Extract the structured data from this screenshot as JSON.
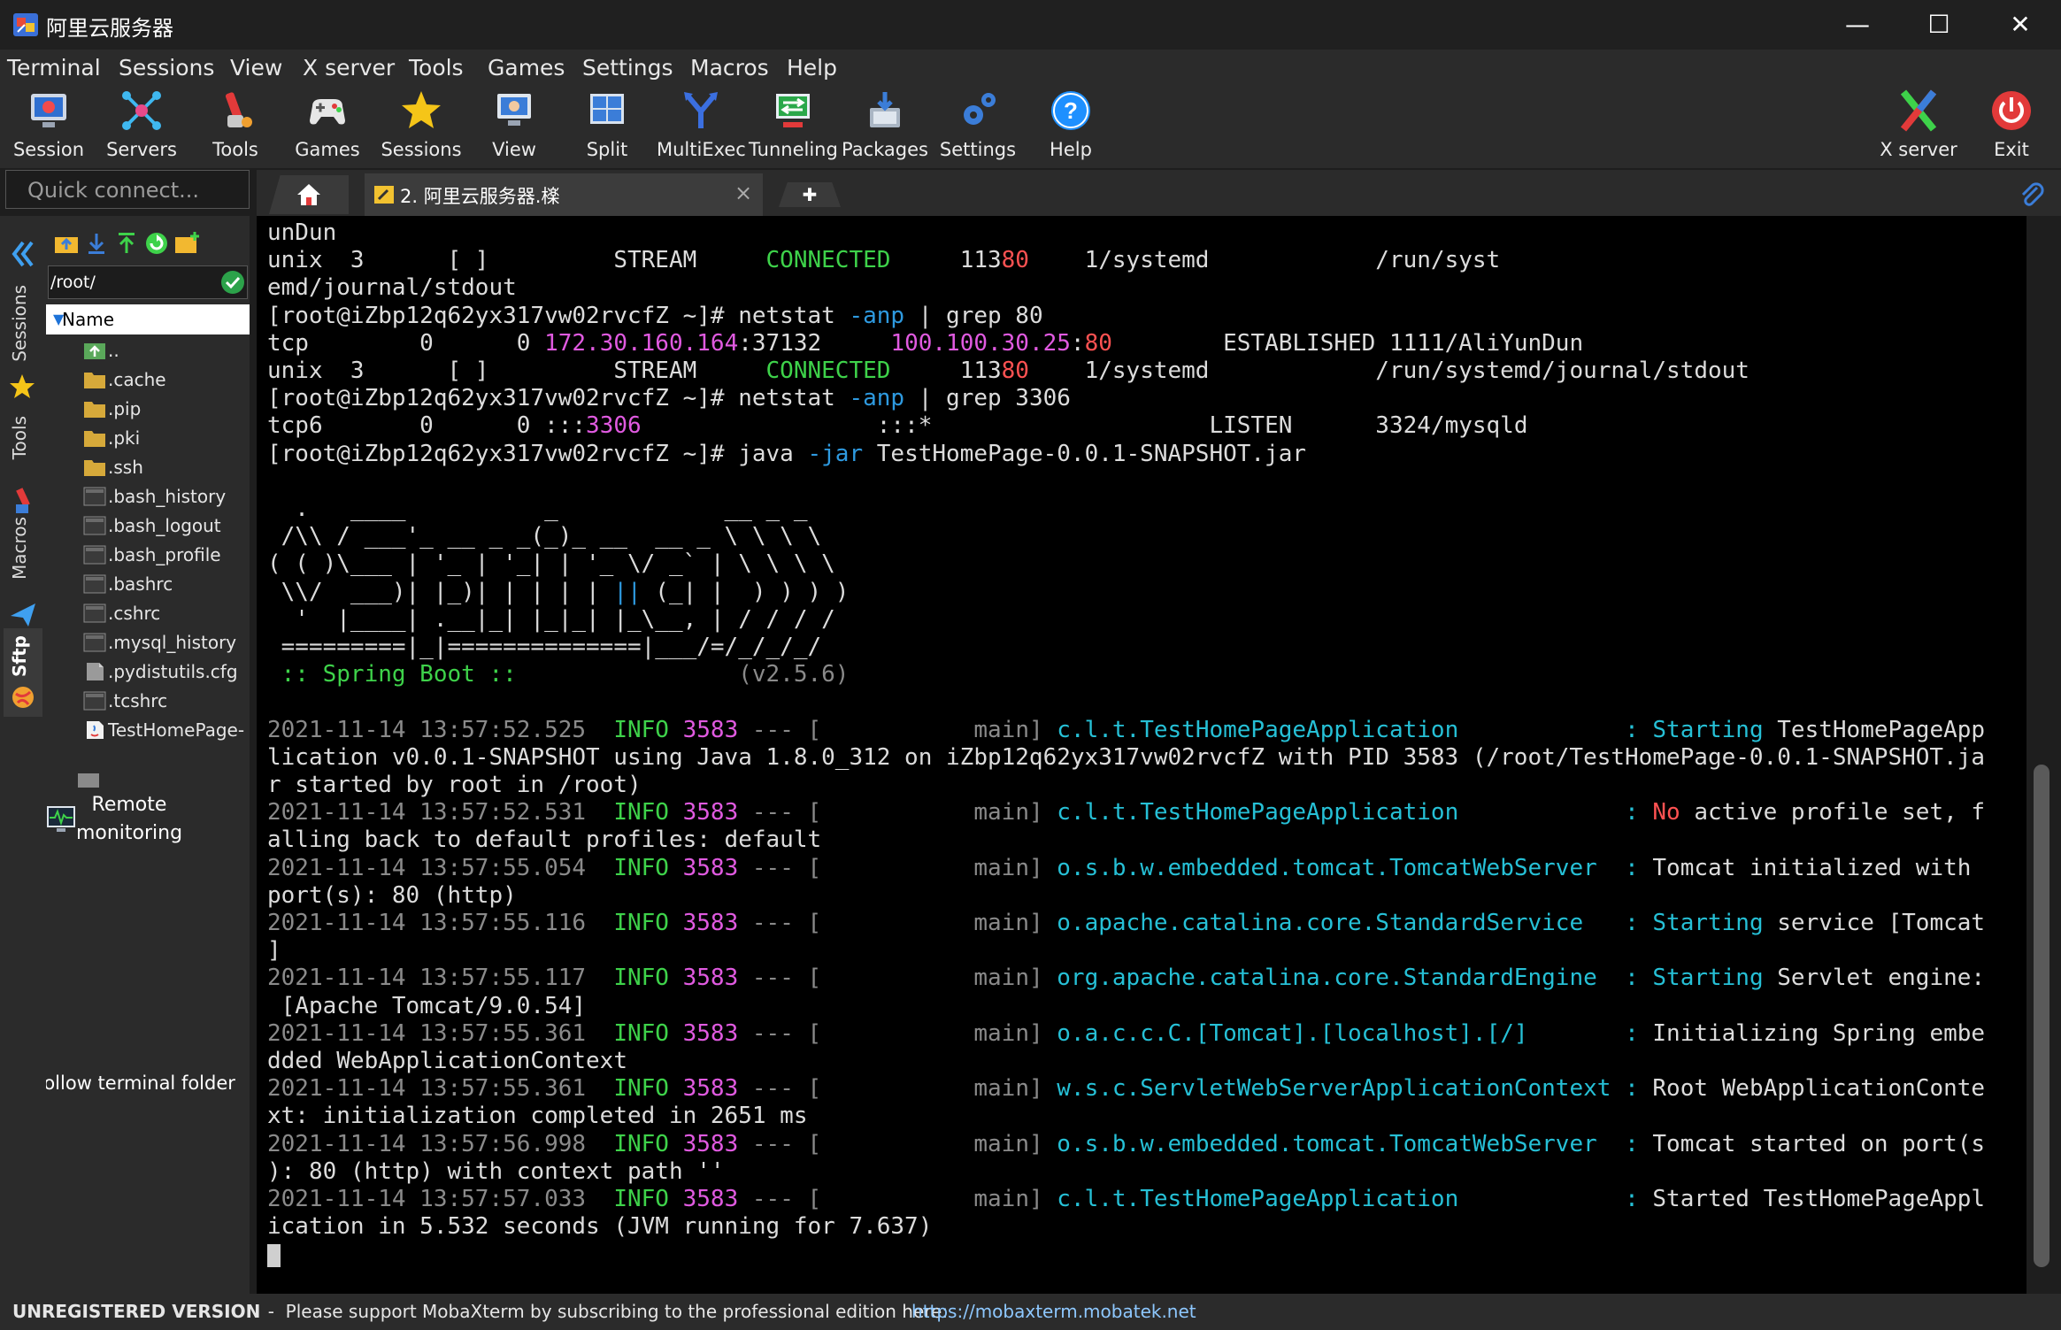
{
  "window": {
    "title": "阿里云服务器",
    "minimize_glyph": "—",
    "maximize_glyph": "☐",
    "close_glyph": "✕"
  },
  "menu": [
    "Terminal",
    "Sessions",
    "View",
    "X server",
    "Tools",
    "Games",
    "Settings",
    "Macros",
    "Help"
  ],
  "toolbar": {
    "items": [
      {
        "label": "Session",
        "icon": "session-icon"
      },
      {
        "label": "Servers",
        "icon": "servers-icon"
      },
      {
        "label": "Tools",
        "icon": "tools-icon"
      },
      {
        "label": "Games",
        "icon": "games-icon"
      },
      {
        "label": "Sessions",
        "icon": "sessions-star-icon"
      },
      {
        "label": "View",
        "icon": "view-icon"
      },
      {
        "label": "Split",
        "icon": "split-icon"
      },
      {
        "label": "MultiExec",
        "icon": "multiexec-icon"
      },
      {
        "label": "Tunneling",
        "icon": "tunneling-icon"
      },
      {
        "label": "Packages",
        "icon": "packages-icon"
      },
      {
        "label": "Settings",
        "icon": "settings-icon"
      },
      {
        "label": "Help",
        "icon": "help-icon"
      }
    ],
    "right": [
      {
        "label": "X server",
        "icon": "xserver-icon"
      },
      {
        "label": "Exit",
        "icon": "exit-icon"
      }
    ]
  },
  "quick_connect": {
    "placeholder": "Quick connect..."
  },
  "tabs": {
    "active_label": "2. 阿里云服务器.檪",
    "close_glyph": "×",
    "new_glyph": "✚"
  },
  "side_tabs": [
    "Sessions",
    "Tools",
    "Macros",
    "Sftp"
  ],
  "sftp": {
    "path": "/root/",
    "column_header": "Name",
    "files": [
      {
        "name": "..",
        "type": "up"
      },
      {
        "name": ".cache",
        "type": "folder"
      },
      {
        "name": ".pip",
        "type": "folder"
      },
      {
        "name": ".pki",
        "type": "folder"
      },
      {
        "name": ".ssh",
        "type": "folder"
      },
      {
        "name": ".bash_history",
        "type": "file"
      },
      {
        "name": ".bash_logout",
        "type": "file"
      },
      {
        "name": ".bash_profile",
        "type": "file"
      },
      {
        "name": ".bashrc",
        "type": "file"
      },
      {
        "name": ".cshrc",
        "type": "file"
      },
      {
        "name": ".mysql_history",
        "type": "file"
      },
      {
        "name": ".pydistutils.cfg",
        "type": "cfg"
      },
      {
        "name": ".tcshrc",
        "type": "file"
      },
      {
        "name": "TestHomePage-",
        "type": "jar"
      }
    ],
    "remote_monitoring": "Remote\nmonitoring",
    "follow_folder": "Follow terminal folder"
  },
  "colors": {
    "green": "#3ed24a",
    "red": "#ff5252",
    "magenta": "#e05ae0",
    "blue": "#2e9ae0",
    "cyan": "#26c0d6",
    "white": "#dcdcdc",
    "gray": "#8a8a8a",
    "bright": "#f2f2f2"
  },
  "terminal": {
    "lines": [
      [
        [
          "unDun",
          "white"
        ]
      ],
      [
        [
          "unix  3      [ ]         STREAM     ",
          "white"
        ],
        [
          "CONNECTED",
          "green"
        ],
        [
          "     113",
          "white"
        ],
        [
          "80",
          "red"
        ],
        [
          "    1/systemd            /run/syst",
          "white"
        ]
      ],
      [
        [
          "emd/journal/stdout",
          "white"
        ]
      ],
      [
        [
          "[root@iZbp12q62yx317vw02rvcfZ ~]# netstat ",
          "white"
        ],
        [
          "-anp",
          "blue"
        ],
        [
          " | grep 80",
          "white"
        ]
      ],
      [
        [
          "tcp        0      0 ",
          "white"
        ],
        [
          "172.30.160.164",
          "magenta"
        ],
        [
          ":37132     ",
          "white"
        ],
        [
          "100.100.30.25",
          "magenta"
        ],
        [
          ":",
          "white"
        ],
        [
          "80",
          "red"
        ],
        [
          "        ESTABLISHED 1111/AliYunDun",
          "white"
        ]
      ],
      [
        [
          "unix  3      [ ]         STREAM     ",
          "white"
        ],
        [
          "CONNECTED",
          "green"
        ],
        [
          "     113",
          "white"
        ],
        [
          "80",
          "red"
        ],
        [
          "    1/systemd            /run/systemd/journal/stdout",
          "white"
        ]
      ],
      [
        [
          "[root@iZbp12q62yx317vw02rvcfZ ~]# netstat ",
          "white"
        ],
        [
          "-anp",
          "blue"
        ],
        [
          " | grep 3306",
          "white"
        ]
      ],
      [
        [
          "tcp6       0      0 ",
          "white"
        ],
        [
          ":::",
          "white"
        ],
        [
          "3306",
          "magenta"
        ],
        [
          "                 :::*                    LISTEN      3324/mysqld",
          "white"
        ]
      ],
      [
        [
          "[root@iZbp12q62yx317vw02rvcfZ ~]# java ",
          "white"
        ],
        [
          "-jar",
          "blue"
        ],
        [
          " TestHomePage-0.0.1-SNAPSHOT.jar",
          "white"
        ]
      ],
      [
        [
          "",
          "white"
        ]
      ],
      [
        [
          "  .   ____          _            __ _ _",
          "white"
        ]
      ],
      [
        [
          " /\\\\ / ___'_ __ _ _(_)_ __  __ _ \\ \\ \\ \\",
          "white"
        ]
      ],
      [
        [
          "( ( )\\___ | '_ | '_| | '_ \\/ _` | \\ \\ \\ \\",
          "white"
        ]
      ],
      [
        [
          " \\\\/  ___)| |_)| | | | | ",
          "white"
        ],
        [
          "||",
          "blue"
        ],
        [
          " (_| |  ) ) ) )",
          "white"
        ]
      ],
      [
        [
          "  '  |____| .__|_| |_|_| |_\\__, | / / / /",
          "white"
        ]
      ],
      [
        [
          " =========|_|==============|___/=/_/_/_/",
          "white"
        ]
      ],
      [
        [
          " :: Spring Boot ::",
          "green"
        ],
        [
          "                (v2.5.6)",
          "gray"
        ]
      ],
      [
        [
          "",
          "white"
        ]
      ],
      [
        [
          "2021-11-14 13:57:52.525  ",
          "gray"
        ],
        [
          "INFO",
          "green"
        ],
        [
          " ",
          "white"
        ],
        [
          "3583",
          "magenta"
        ],
        [
          " --- [           main] ",
          "gray"
        ],
        [
          "c.l.t.TestHomePageApplication",
          "cyan"
        ],
        [
          "            : ",
          "cyan"
        ],
        [
          "Starting",
          "cyan"
        ],
        [
          " TestHomePageApp",
          "white"
        ]
      ],
      [
        [
          "lication v0.0.1-SNAPSHOT using Java 1.8.0_312 on iZbp12q62yx317vw02rvcfZ with PID 3583 (/root/TestHomePage-0.0.1-SNAPSHOT.ja",
          "white"
        ]
      ],
      [
        [
          "r started by root in /root)",
          "white"
        ]
      ],
      [
        [
          "2021-11-14 13:57:52.531  ",
          "gray"
        ],
        [
          "INFO",
          "green"
        ],
        [
          " ",
          "white"
        ],
        [
          "3583",
          "magenta"
        ],
        [
          " --- [           main] ",
          "gray"
        ],
        [
          "c.l.t.TestHomePageApplication",
          "cyan"
        ],
        [
          "            : ",
          "cyan"
        ],
        [
          "No",
          "red"
        ],
        [
          " active profile set, f",
          "white"
        ]
      ],
      [
        [
          "alling back to default profiles: default",
          "white"
        ]
      ],
      [
        [
          "2021-11-14 13:57:55.054  ",
          "gray"
        ],
        [
          "INFO",
          "green"
        ],
        [
          " ",
          "white"
        ],
        [
          "3583",
          "magenta"
        ],
        [
          " --- [           main] ",
          "gray"
        ],
        [
          "o.s.b.w.embedded.tomcat.TomcatWebServer",
          "cyan"
        ],
        [
          "  : ",
          "cyan"
        ],
        [
          "Tomcat initialized with",
          "white"
        ]
      ],
      [
        [
          "port(s): 80 (http)",
          "white"
        ]
      ],
      [
        [
          "2021-11-14 13:57:55.116  ",
          "gray"
        ],
        [
          "INFO",
          "green"
        ],
        [
          " ",
          "white"
        ],
        [
          "3583",
          "magenta"
        ],
        [
          " --- [           main] ",
          "gray"
        ],
        [
          "o.apache.catalina.core.StandardService",
          "cyan"
        ],
        [
          "   : ",
          "cyan"
        ],
        [
          "Starting",
          "cyan"
        ],
        [
          " service [Tomcat",
          "white"
        ]
      ],
      [
        [
          "]",
          "white"
        ]
      ],
      [
        [
          "2021-11-14 13:57:55.117  ",
          "gray"
        ],
        [
          "INFO",
          "green"
        ],
        [
          " ",
          "white"
        ],
        [
          "3583",
          "magenta"
        ],
        [
          " --- [           main] ",
          "gray"
        ],
        [
          "org.apache.catalina.core.StandardEngine",
          "cyan"
        ],
        [
          "  : ",
          "cyan"
        ],
        [
          "Starting",
          "cyan"
        ],
        [
          " Servlet engine:",
          "white"
        ]
      ],
      [
        [
          " [Apache Tomcat/9.0.54]",
          "white"
        ]
      ],
      [
        [
          "2021-11-14 13:57:55.361  ",
          "gray"
        ],
        [
          "INFO",
          "green"
        ],
        [
          " ",
          "white"
        ],
        [
          "3583",
          "magenta"
        ],
        [
          " --- [           main] ",
          "gray"
        ],
        [
          "o.a.c.c.C.[Tomcat].[localhost].[/]",
          "cyan"
        ],
        [
          "       : ",
          "cyan"
        ],
        [
          "Initializing Spring embe",
          "white"
        ]
      ],
      [
        [
          "dded WebApplicationContext",
          "white"
        ]
      ],
      [
        [
          "2021-11-14 13:57:55.361  ",
          "gray"
        ],
        [
          "INFO",
          "green"
        ],
        [
          " ",
          "white"
        ],
        [
          "3583",
          "magenta"
        ],
        [
          " --- [           main] ",
          "gray"
        ],
        [
          "w.s.c.ServletWebServerApplicationContext",
          "cyan"
        ],
        [
          " : ",
          "cyan"
        ],
        [
          "Root WebApplicationConte",
          "white"
        ]
      ],
      [
        [
          "xt: initialization completed in 2651 ms",
          "white"
        ]
      ],
      [
        [
          "2021-11-14 13:57:56.998  ",
          "gray"
        ],
        [
          "INFO",
          "green"
        ],
        [
          " ",
          "white"
        ],
        [
          "3583",
          "magenta"
        ],
        [
          " --- [           main] ",
          "gray"
        ],
        [
          "o.s.b.w.embedded.tomcat.TomcatWebServer",
          "cyan"
        ],
        [
          "  : ",
          "cyan"
        ],
        [
          "Tomcat started on port(s",
          "white"
        ]
      ],
      [
        [
          "): 80 (http) with context path ''",
          "white"
        ]
      ],
      [
        [
          "2021-11-14 13:57:57.033  ",
          "gray"
        ],
        [
          "INFO",
          "green"
        ],
        [
          " ",
          "white"
        ],
        [
          "3583",
          "magenta"
        ],
        [
          " --- [           main] ",
          "gray"
        ],
        [
          "c.l.t.TestHomePageApplication",
          "cyan"
        ],
        [
          "            : ",
          "cyan"
        ],
        [
          "Started TestHomePageAppl",
          "white"
        ]
      ],
      [
        [
          "ication in 5.532 seconds (JVM running for 7.637)",
          "white"
        ]
      ]
    ]
  },
  "status": {
    "unregistered": "UNREGISTERED VERSION",
    "message": "  -  Please support MobaXterm by subscribing to the professional edition here:  ",
    "link": "https://mobaxterm.mobatek.net"
  }
}
